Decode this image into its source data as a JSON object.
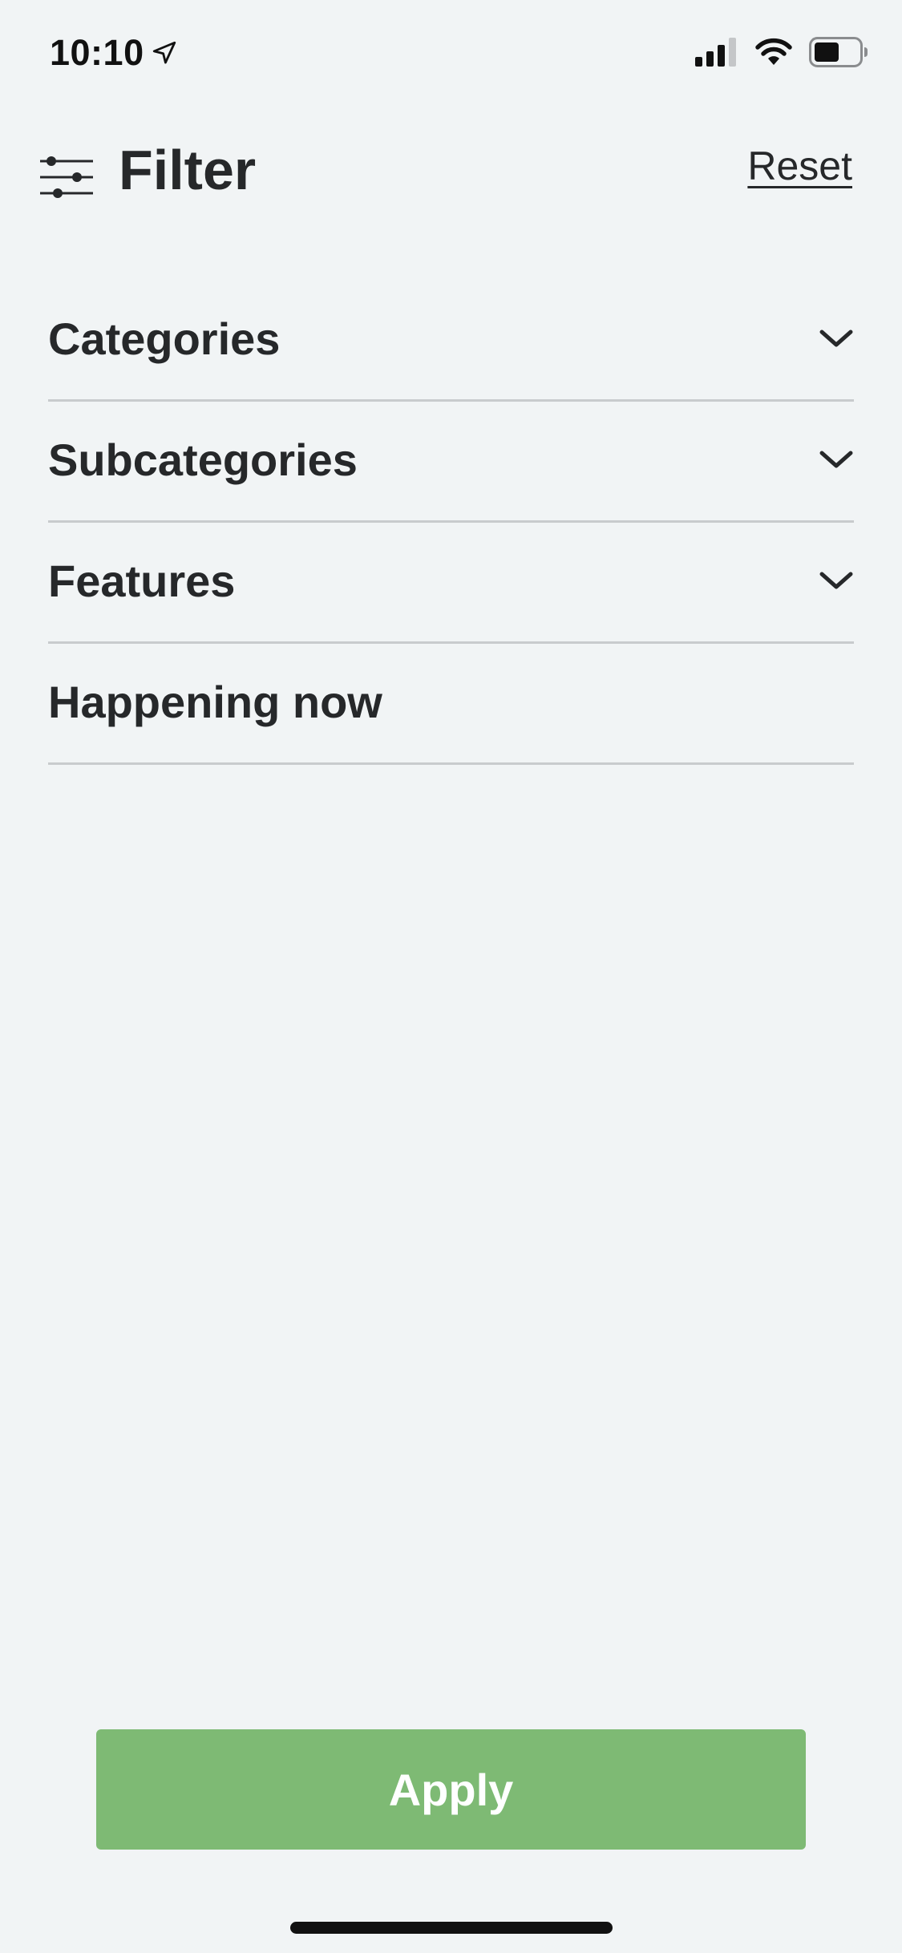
{
  "status_bar": {
    "time": "10:10",
    "icons": [
      "location-arrow-icon",
      "cellular-signal-icon",
      "wifi-icon",
      "battery-icon"
    ]
  },
  "header": {
    "icon": "sliders-icon",
    "title": "Filter",
    "reset_label": "Reset"
  },
  "filters": [
    {
      "label": "Categories",
      "expandable": true,
      "icon": "chevron-down-icon"
    },
    {
      "label": "Subcategories",
      "expandable": true,
      "icon": "chevron-down-icon"
    },
    {
      "label": "Features",
      "expandable": true,
      "icon": "chevron-down-icon"
    },
    {
      "label": "Happening now",
      "expandable": false
    }
  ],
  "apply_button": {
    "label": "Apply"
  },
  "colors": {
    "background": "#f1f4f5",
    "text": "#26282a",
    "divider": "#c8cbcd",
    "accent_green": "#7eba74"
  }
}
